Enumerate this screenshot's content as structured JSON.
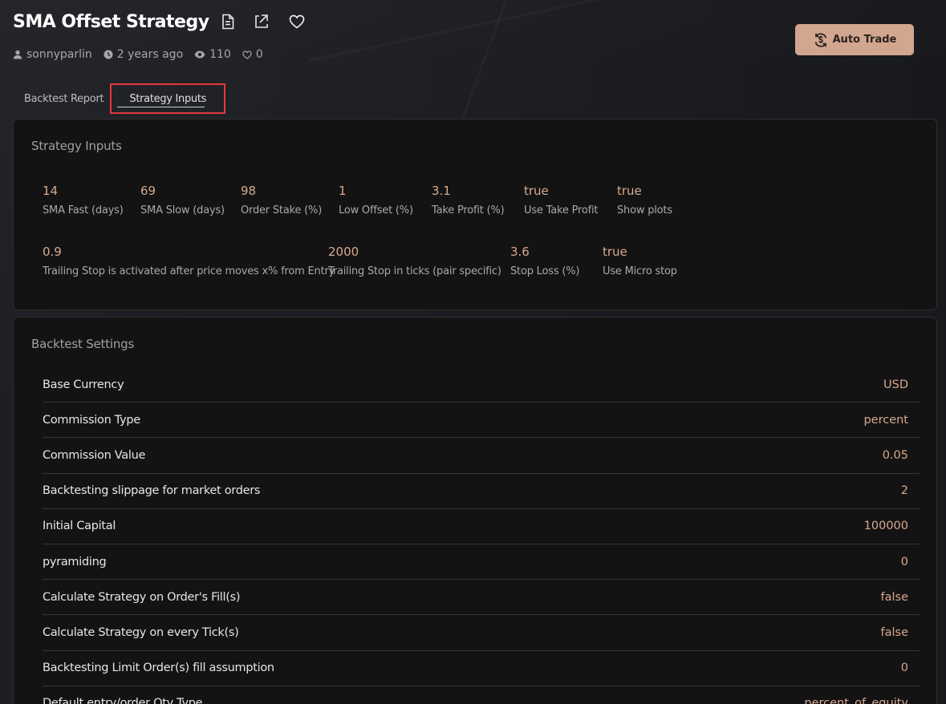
{
  "header": {
    "title": "SMA Offset Strategy",
    "icons": [
      "document-icon",
      "export-icon",
      "heart-icon"
    ]
  },
  "meta": {
    "author": "sonnyparlin",
    "age": "2 years ago",
    "views": "110",
    "likes": "0"
  },
  "actions": {
    "auto_trade_label": "Auto Trade"
  },
  "tabs": [
    {
      "label": "Backtest Report",
      "active": false
    },
    {
      "label": "Strategy Inputs",
      "active": true
    }
  ],
  "strategy_inputs": {
    "title": "Strategy Inputs",
    "items": [
      {
        "value": "14",
        "label": "SMA Fast (days)"
      },
      {
        "value": "69",
        "label": "SMA Slow (days)"
      },
      {
        "value": "98",
        "label": "Order Stake (%)"
      },
      {
        "value": "1",
        "label": "Low Offset (%)"
      },
      {
        "value": "3.1",
        "label": "Take Profit (%)"
      },
      {
        "value": "true",
        "label": "Use Take Profit"
      },
      {
        "value": "true",
        "label": "Show plots"
      },
      {
        "value": "0.9",
        "label": "Trailing Stop is activated after price moves x% from Entry"
      },
      {
        "value": "2000",
        "label": "Trailing Stop in ticks (pair specific)"
      },
      {
        "value": "3.6",
        "label": "Stop Loss (%)"
      },
      {
        "value": "true",
        "label": "Use Micro stop"
      }
    ]
  },
  "backtest_settings": {
    "title": "Backtest Settings",
    "rows": [
      {
        "name": "Base Currency",
        "value": "USD"
      },
      {
        "name": "Commission Type",
        "value": "percent"
      },
      {
        "name": "Commission Value",
        "value": "0.05"
      },
      {
        "name": "Backtesting slippage for market orders",
        "value": "2"
      },
      {
        "name": "Initial Capital",
        "value": "100000"
      },
      {
        "name": "pyramiding",
        "value": "0"
      },
      {
        "name": "Calculate Strategy on Order's Fill(s)",
        "value": "false"
      },
      {
        "name": "Calculate Strategy on every Tick(s)",
        "value": "false"
      },
      {
        "name": "Backtesting Limit Order(s) fill assumption",
        "value": "0"
      },
      {
        "name": "Default entry/order Qty Type",
        "value": "percent_of_equity"
      }
    ]
  },
  "colors": {
    "accent": "#d2a68f",
    "value_text": "#d9a98c",
    "highlight_border": "#e2383d"
  }
}
